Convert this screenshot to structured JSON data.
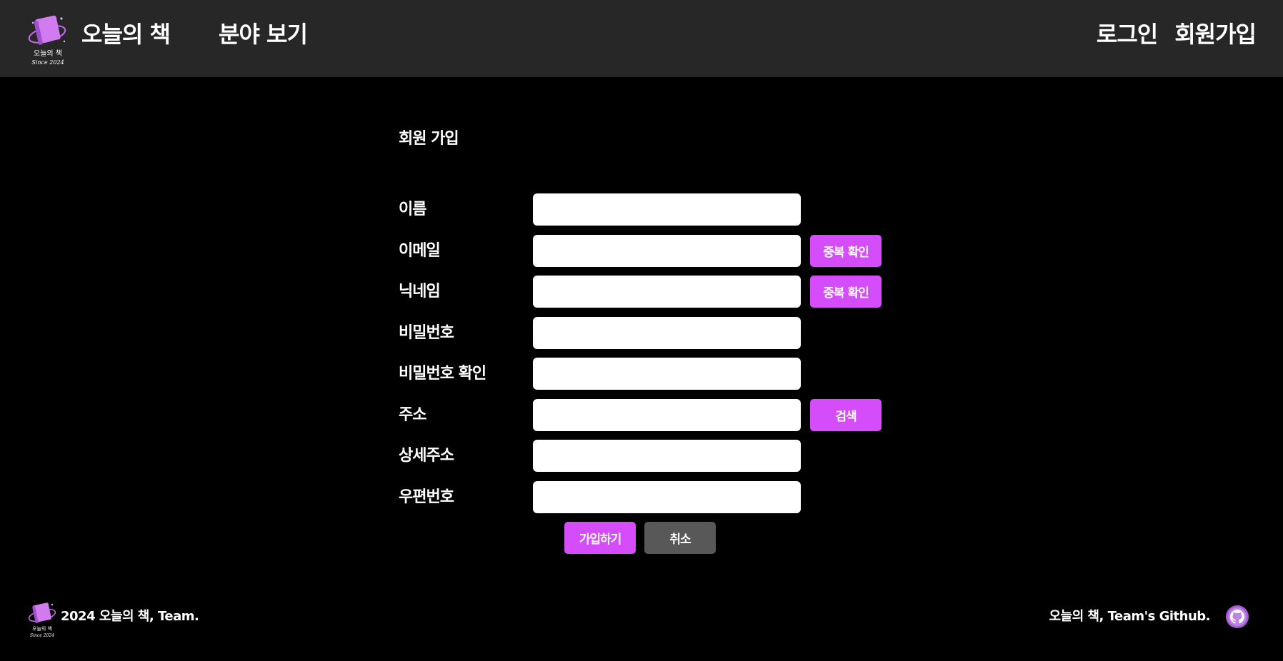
{
  "header": {
    "logo_text": "오늘의 책",
    "logo_subtext": "Since 2024",
    "brand": "오늘의 책",
    "nav_genre": "분야 보기",
    "login": "로그인",
    "signup": "회원가입"
  },
  "form": {
    "title": "회원 가입",
    "fields": [
      {
        "label": "이름",
        "value": ""
      },
      {
        "label": "이메일",
        "value": "",
        "button": "중복 확인"
      },
      {
        "label": "닉네임",
        "value": "",
        "button": "중복 확인"
      },
      {
        "label": "비밀번호",
        "value": ""
      },
      {
        "label": "비밀번호 확인",
        "value": ""
      },
      {
        "label": "주소",
        "value": "",
        "button": "검색"
      },
      {
        "label": "상세주소",
        "value": ""
      },
      {
        "label": "우편번호",
        "value": ""
      }
    ],
    "submit": "가입하기",
    "cancel": "취소"
  },
  "footer": {
    "copyright": "2024 오늘의 책, Team.",
    "github": "오늘의 책, Team's Github."
  },
  "colors": {
    "header_bg": "#272727",
    "page_bg": "#000000",
    "accent": "#d54dfa",
    "cancel": "#585858",
    "github_icon": "#a85cd6"
  }
}
